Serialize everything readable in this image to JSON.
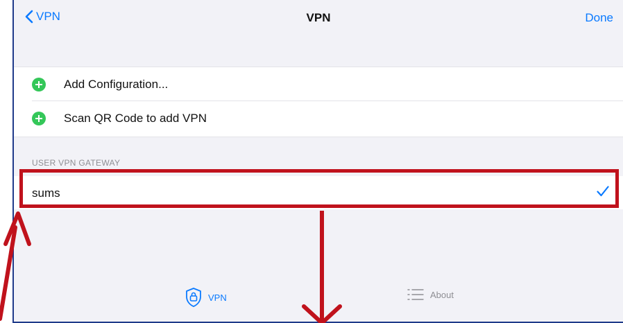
{
  "navbar": {
    "back_label": "VPN",
    "title": "VPN",
    "done_label": "Done"
  },
  "actions": [
    {
      "label": "Add Configuration..."
    },
    {
      "label": "Scan QR Code to add VPN"
    }
  ],
  "gateway_section": {
    "header": "USER VPN GATEWAY",
    "items": [
      {
        "label": "sums",
        "selected": true
      }
    ]
  },
  "tabbar": {
    "tabs": [
      {
        "label": "VPN",
        "active": true,
        "icon": "shield-lock-icon"
      },
      {
        "label": "About",
        "active": false,
        "icon": "list-icon"
      }
    ]
  },
  "colors": {
    "accent": "#0a7aff",
    "add_green": "#34c759",
    "annotation_red": "#c0121c"
  }
}
